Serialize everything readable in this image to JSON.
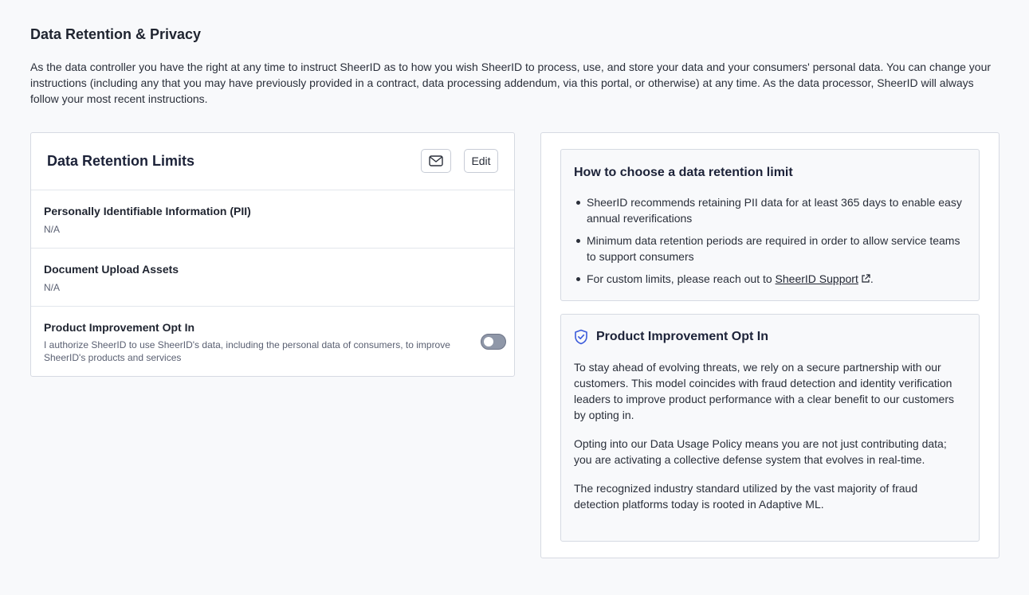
{
  "page": {
    "title": "Data Retention & Privacy",
    "intro": "As the data controller you have the right at any time to instruct SheerID as to how you wish SheerID to process, use, and store your data and your consumers' personal data. You can change your instructions (including any that you may have previously provided in a contract, data processing addendum, via this portal, or otherwise) at any time. As the data processor, SheerID will always follow your most recent instructions."
  },
  "limits_card": {
    "title": "Data Retention Limits",
    "mail_icon": "envelope-icon",
    "edit_label": "Edit",
    "rows": [
      {
        "label": "Personally Identifiable Information (PII)",
        "value": "N/A"
      },
      {
        "label": "Document Upload Assets",
        "value": "N/A"
      },
      {
        "label": "Product Improvement Opt In",
        "description": "I authorize SheerID to use SheerID's data, including the personal data of consumers, to improve SheerID's products and services",
        "toggle_on": false
      }
    ]
  },
  "guide_panel": {
    "title": "How to choose a data retention limit",
    "bullets": [
      "SheerID recommends retaining PII data for at least 365 days to enable easy annual reverifications",
      "Minimum data retention periods are required in order to allow service teams to support consumers"
    ],
    "custom_prefix": "For custom limits, please reach out to ",
    "support_link": "SheerID Support",
    "custom_suffix": ".",
    "link_icon": "external-link-icon"
  },
  "opt_in_panel": {
    "icon": "shield-check-icon",
    "title": "Product Improvement Opt In",
    "paragraphs": [
      "To stay ahead of evolving threats, we rely on a secure partnership with our customers. This model coincides with fraud detection and identity verification leaders to improve product performance with a clear benefit to our customers by opting in.",
      "Opting into our Data Usage Policy means you are not just contributing data; you are activating a collective defense system that evolves in real-time.",
      "The recognized industry standard utilized by the vast majority of fraud detection platforms today is rooted in Adaptive ML."
    ]
  },
  "colors": {
    "background": "#f8f9fb",
    "card_border": "#d6dae2",
    "heading": "#1c2238",
    "toggle_off": "#8f97a8",
    "shield_accent": "#3b5bdb"
  }
}
